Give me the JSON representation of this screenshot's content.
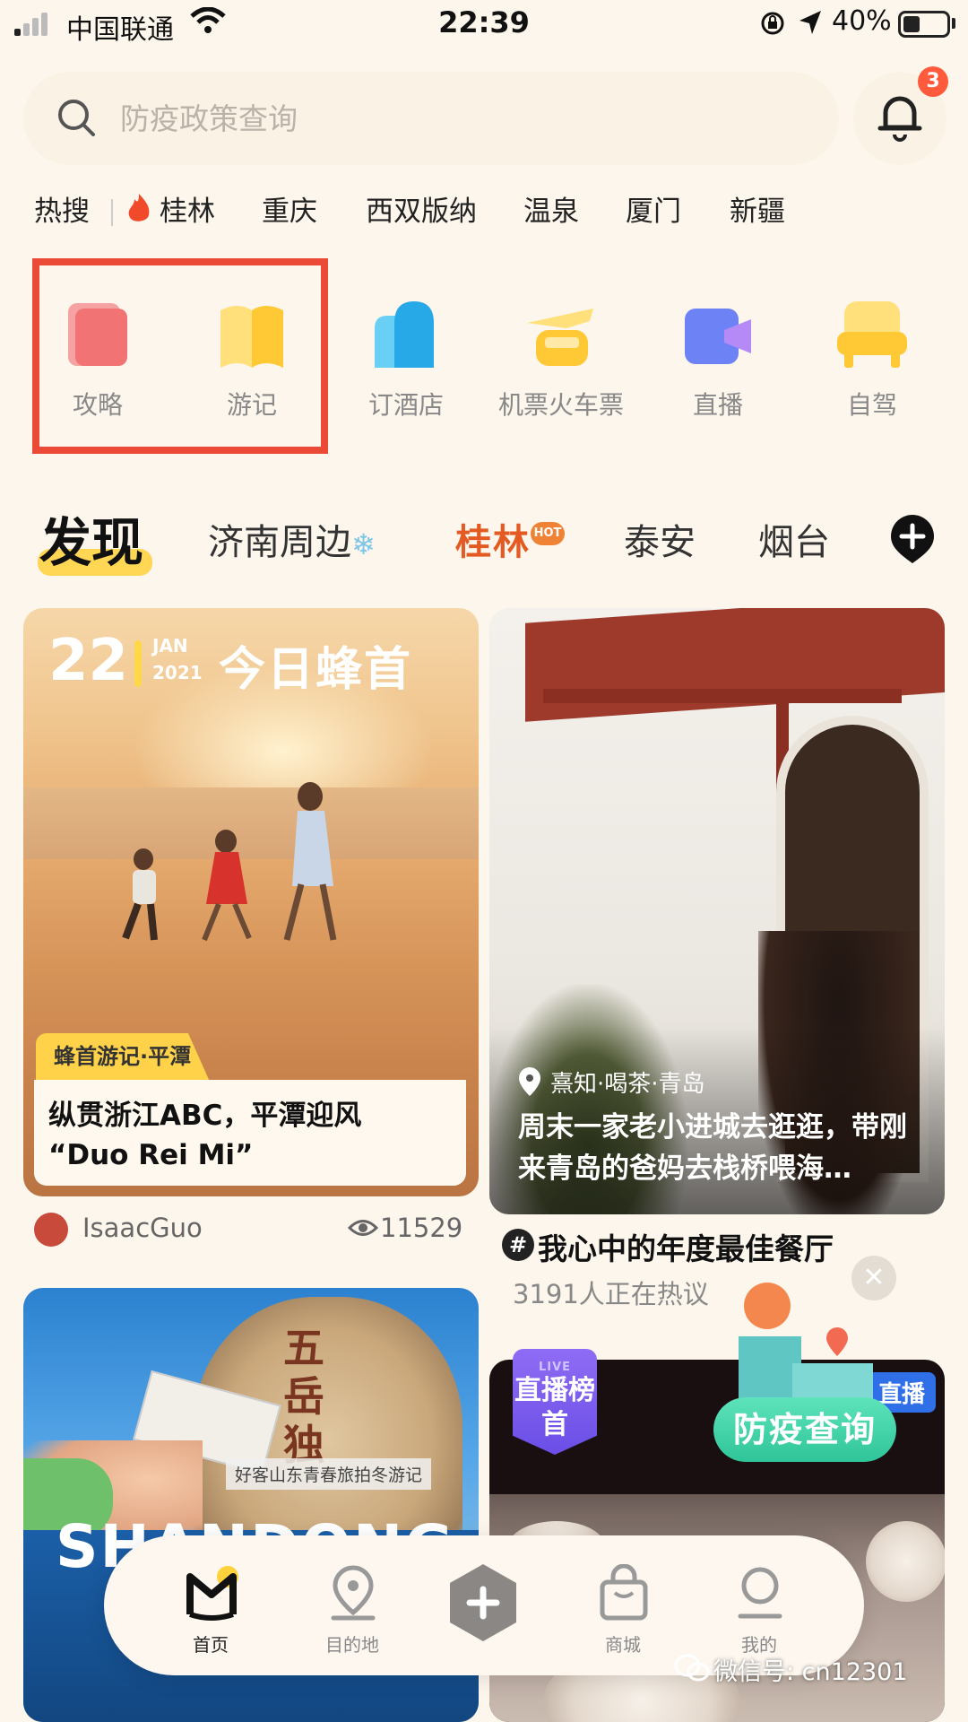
{
  "status_bar": {
    "carrier": "中国联通",
    "time": "22:39",
    "battery_pct": "40%",
    "battery_level": 0.4
  },
  "search": {
    "placeholder": "防疫政策查询",
    "notification_count": "3"
  },
  "hot_search": {
    "label": "热搜",
    "items": [
      "桂林",
      "重庆",
      "西双版纳",
      "温泉",
      "厦门",
      "新疆"
    ]
  },
  "shortcuts": [
    {
      "label": "攻略",
      "icon": "guide-icon",
      "color": "#f47c7c"
    },
    {
      "label": "游记",
      "icon": "travelogue-icon",
      "color": "#ffd34d"
    },
    {
      "label": "订酒店",
      "icon": "hotel-icon",
      "color": "#3bb8ee"
    },
    {
      "label": "机票火车票",
      "icon": "plane-train-icon",
      "color": "#ffd34d"
    },
    {
      "label": "直播",
      "icon": "live-icon",
      "color": "#7b8cf5"
    },
    {
      "label": "自驾",
      "icon": "car-seat-icon",
      "color": "#ffd34d"
    }
  ],
  "discover_tabs": {
    "active": "发现",
    "items": [
      "济南周边",
      "桂林",
      "泰安",
      "烟台"
    ],
    "hot_badge": "HOT"
  },
  "feed": {
    "card1": {
      "day": "22",
      "month": "JAN",
      "year": "2021",
      "banner": "今日蜂首",
      "tag": "蜂首游记·平潭",
      "title_line1": "纵贯浙江ABC，平潭迎风",
      "title_line2": "“Duo Rei Mi”",
      "author": "IsaacGuo",
      "views": "11529"
    },
    "card2": {
      "location": "熹知·喝茶·青岛",
      "title": "周末一家老小进城去逛逛，带刚来青岛的爸妈去栈桥喂海…",
      "topic": "我心中的年度最佳餐厅",
      "topic_sub": "3191人正在热议"
    },
    "card3": {
      "caption": "好客山东青春旅拍冬游记",
      "big_text": "SHANDONG",
      "rock_text": "五岳独"
    },
    "card4": {
      "rank_label": "直播榜首",
      "live_tag": "直播"
    }
  },
  "float_button": {
    "label": "防疫查询"
  },
  "bottom_nav": [
    {
      "label": "首页",
      "icon": "home-icon"
    },
    {
      "label": "目的地",
      "icon": "location-pin-icon"
    },
    {
      "label": "",
      "icon": "plus-icon"
    },
    {
      "label": "商城",
      "icon": "shopping-bag-icon"
    },
    {
      "label": "我的",
      "icon": "user-icon"
    }
  ],
  "watermark": "微信号: cn12301"
}
